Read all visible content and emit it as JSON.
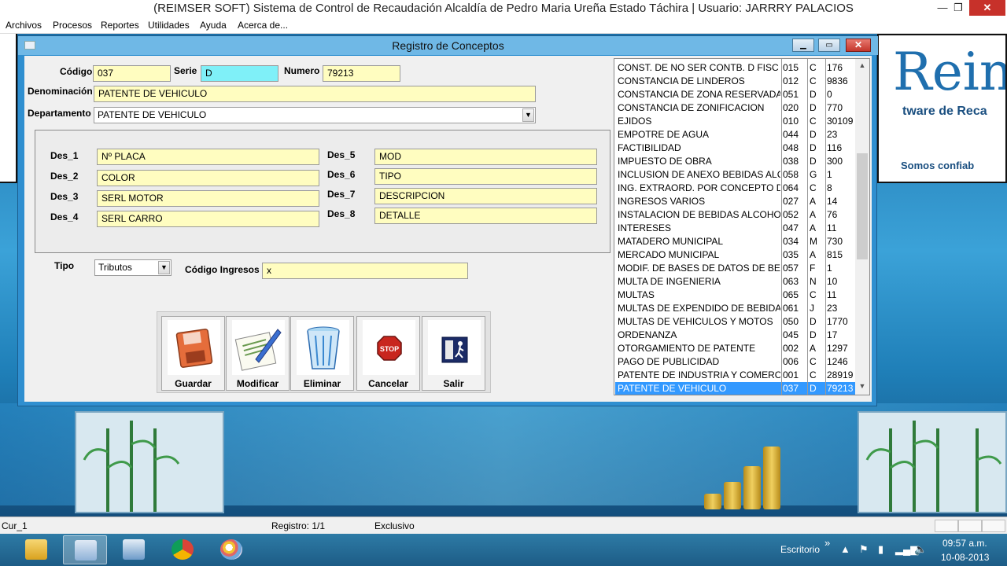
{
  "window": {
    "title": "(REIMSER SOFT) Sistema de Control de Recaudación Alcaldía de Pedro Maria Ureña Estado Táchira | Usuario: JARRRY PALACIOS"
  },
  "menu": [
    "Archivos",
    "Procesos",
    "Reportes",
    "Utilidades",
    "Ayuda",
    "Acerca de..."
  ],
  "background": {
    "logo_text": "Rein",
    "logo_sub": "tware de Reca",
    "logo_slogan": "Somos confiab"
  },
  "dialog": {
    "title": "Registro de Conceptos",
    "form": {
      "codigo_label": "Código",
      "codigo_value": "037",
      "serie_label": "Serie",
      "serie_value": "D",
      "numero_label": "Numero",
      "numero_value": "79213",
      "denominacion_label": "Denominación",
      "denominacion_value": "PATENTE DE VEHICULO",
      "departamento_label": "Departamento",
      "departamento_value": "PATENTE DE VEHICULO",
      "tipo_label": "Tipo",
      "tipo_value": "Tributos",
      "codigo_ingresos_label": "Código Ingresos",
      "codigo_ingresos_value": "x"
    },
    "descriptors": [
      {
        "label": "Des_1",
        "value": "Nº PLACA"
      },
      {
        "label": "Des_2",
        "value": "COLOR"
      },
      {
        "label": "Des_3",
        "value": "SERL  MOTOR"
      },
      {
        "label": "Des_4",
        "value": "SERL CARRO"
      },
      {
        "label": "Des_5",
        "value": "MOD"
      },
      {
        "label": "Des_6",
        "value": "TIPO"
      },
      {
        "label": "Des_7",
        "value": "DESCRIPCION"
      },
      {
        "label": "Des_8",
        "value": "DETALLE"
      }
    ],
    "buttons": [
      {
        "label": "Guardar",
        "icon": "floppy-disk-icon"
      },
      {
        "label": "Modificar",
        "icon": "edit-document-icon"
      },
      {
        "label": "Eliminar",
        "icon": "recycle-bin-icon"
      },
      {
        "label": "Cancelar",
        "icon": "stop-sign-icon"
      },
      {
        "label": "Salir",
        "icon": "exit-door-icon"
      }
    ],
    "stop_text": "STOP",
    "list_rows": [
      [
        "CONST. DE NO SER CONTB. D FISC",
        "015",
        "C",
        "176"
      ],
      [
        "CONSTANCIA DE LINDEROS",
        "012",
        "C",
        "9836"
      ],
      [
        "CONSTANCIA DE ZONA RESERVADA",
        "051",
        "D",
        "0"
      ],
      [
        "CONSTANCIA DE ZONIFICACION",
        "020",
        "D",
        "770"
      ],
      [
        "EJIDOS",
        "010",
        "C",
        "30109"
      ],
      [
        "EMPOTRE DE AGUA",
        "044",
        "D",
        "23"
      ],
      [
        "FACTIBILIDAD",
        "048",
        "D",
        "116"
      ],
      [
        "IMPUESTO DE OBRA",
        "038",
        "D",
        "300"
      ],
      [
        "INCLUSION DE ANEXO BEBIDAS ALC",
        "058",
        "G",
        "1"
      ],
      [
        "ING. EXTRAORD. POR CONCEPTO DI",
        "064",
        "C",
        "8"
      ],
      [
        "INGRESOS VARIOS",
        "027",
        "A",
        "14"
      ],
      [
        "INSTALACION DE BEBIDAS ALCOHOL",
        "052",
        "A",
        "76"
      ],
      [
        "INTERESES",
        "047",
        "A",
        "11"
      ],
      [
        "MATADERO MUNICIPAL",
        "034",
        "M",
        "730"
      ],
      [
        "MERCADO MUNICIPAL",
        "035",
        "A",
        "815"
      ],
      [
        "MODIF. DE BASES DE DATOS DE BEB",
        "057",
        "F",
        "1"
      ],
      [
        "MULTA DE INGENIERIA",
        "063",
        "N",
        "10"
      ],
      [
        "MULTAS",
        "065",
        "C",
        "11"
      ],
      [
        "MULTAS DE EXPENDIDO DE BEBIDAS",
        "061",
        "J",
        "23"
      ],
      [
        "MULTAS DE VEHICULOS Y MOTOS",
        "050",
        "D",
        "1770"
      ],
      [
        "ORDENANZA",
        "045",
        "D",
        "17"
      ],
      [
        "OTORGAMIENTO DE PATENTE",
        "002",
        "A",
        "1297"
      ],
      [
        "PAGO DE PUBLICIDAD",
        "006",
        "C",
        "1246"
      ],
      [
        "PATENTE DE INDUSTRIA Y COMERCIO",
        "001",
        "C",
        "28919"
      ],
      [
        "PATENTE DE VEHICULO",
        "037",
        "D",
        "79213"
      ]
    ],
    "selected_row": 24
  },
  "status": {
    "cursor": "Cur_1",
    "registro": "Registro: 1/1",
    "modo": "Exclusivo"
  },
  "taskbar": {
    "escritorio": "Escritorio",
    "chevron": "»",
    "time": "09:57 a.m.",
    "date": "10-08-2013"
  },
  "colors": {
    "field_yellow": "#fffdc0",
    "field_cyan": "#7ff0f8",
    "selection_blue": "#3399ff"
  }
}
